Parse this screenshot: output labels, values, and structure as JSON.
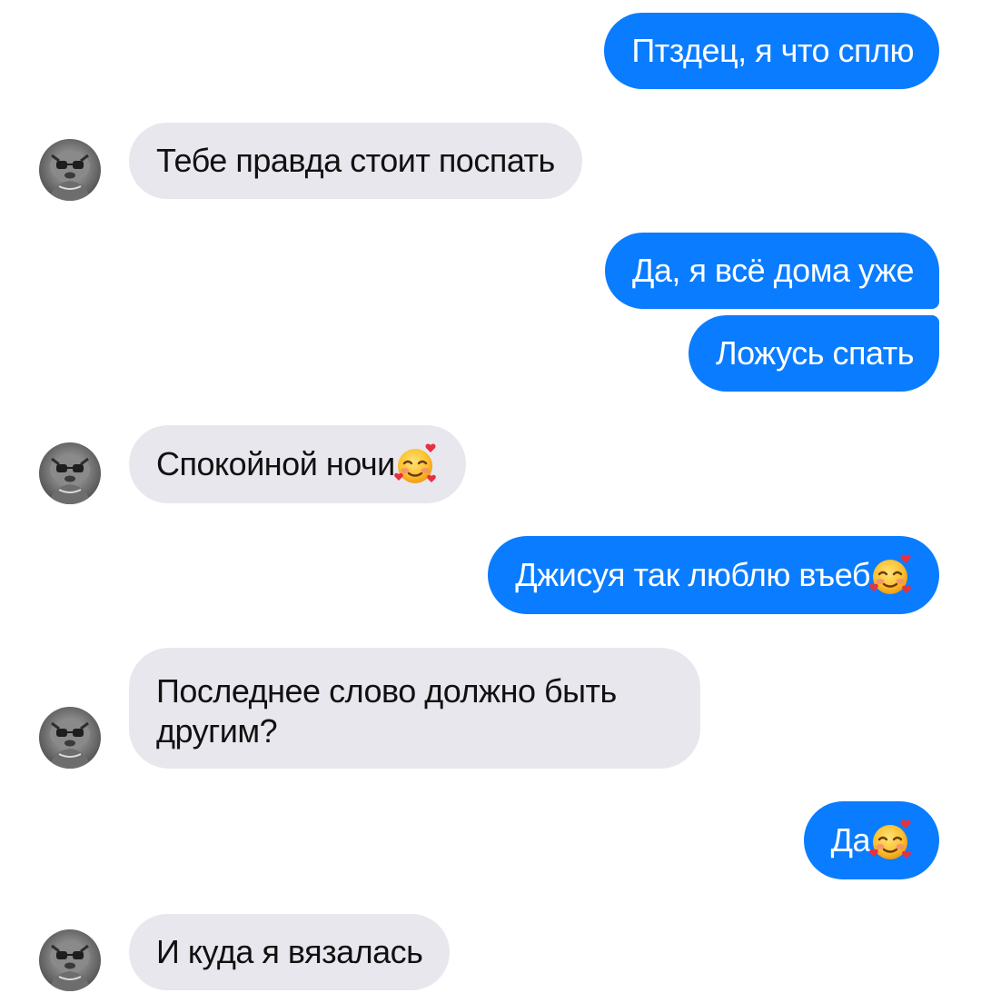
{
  "chat": {
    "colors": {
      "outgoing_bubble": "#0a7cff",
      "incoming_bubble": "#e8e7ee",
      "outgoing_text": "#ffffff",
      "incoming_text": "#111111"
    },
    "messages": [
      {
        "id": "m1",
        "direction": "outgoing",
        "text": "Птздец, я что сплю"
      },
      {
        "id": "m2",
        "direction": "incoming",
        "text": "Тебе правда стоит поспать"
      },
      {
        "id": "m3",
        "direction": "outgoing",
        "text": "Да, я всё дома уже"
      },
      {
        "id": "m4",
        "direction": "outgoing",
        "text": "Ложусь спать"
      },
      {
        "id": "m5",
        "direction": "incoming",
        "text": "Спокойной ночи",
        "emoji": "smiling-face-with-hearts-emoji"
      },
      {
        "id": "m6",
        "direction": "outgoing",
        "text": "Джисуя так люблю въеб",
        "emoji": "smiling-face-with-hearts-emoji"
      },
      {
        "id": "m7",
        "direction": "incoming",
        "text": "Последнее слово должно быть другим?"
      },
      {
        "id": "m8",
        "direction": "outgoing",
        "text": "Да",
        "emoji": "smiling-face-with-hearts-emoji"
      },
      {
        "id": "m9",
        "direction": "incoming",
        "text": "И куда я вязалась"
      }
    ],
    "avatar_icon": "contact-avatar-photo"
  }
}
